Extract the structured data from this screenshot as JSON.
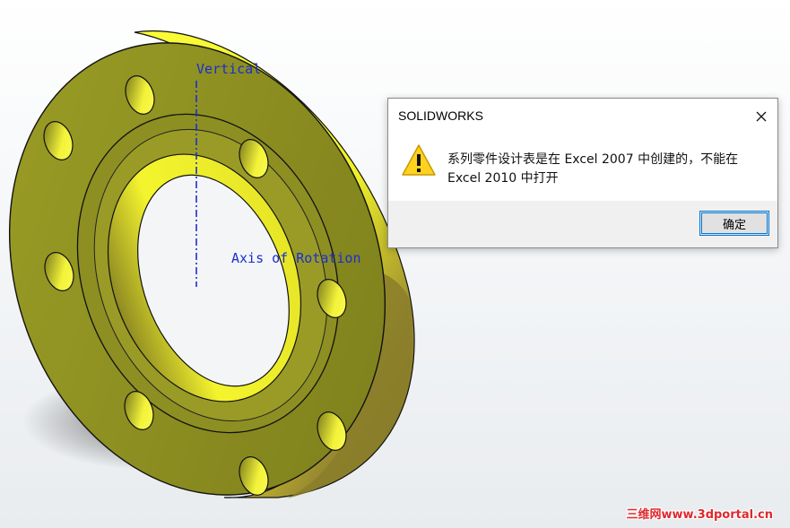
{
  "viewport": {
    "axis_labels": {
      "vertical": "Vertical",
      "rotation": "Axis of Rotation"
    },
    "model": "flange-part",
    "colors": {
      "face": "#8a8c22",
      "face_light": "#bcbf2a",
      "rim": "#f6f628",
      "bore": "#eaea28",
      "edge": "#111111",
      "axis": "#1a2fd0"
    }
  },
  "dialog": {
    "title": "SOLIDWORKS",
    "message_line1": "系列零件设计表是在 Excel 2007 中创建的，不能在",
    "message_line2": "Excel 2010 中打开",
    "ok_label": "确定",
    "icon": "warning-icon",
    "close_icon": "close-icon"
  },
  "watermark": "三维网www.3dportal.cn"
}
